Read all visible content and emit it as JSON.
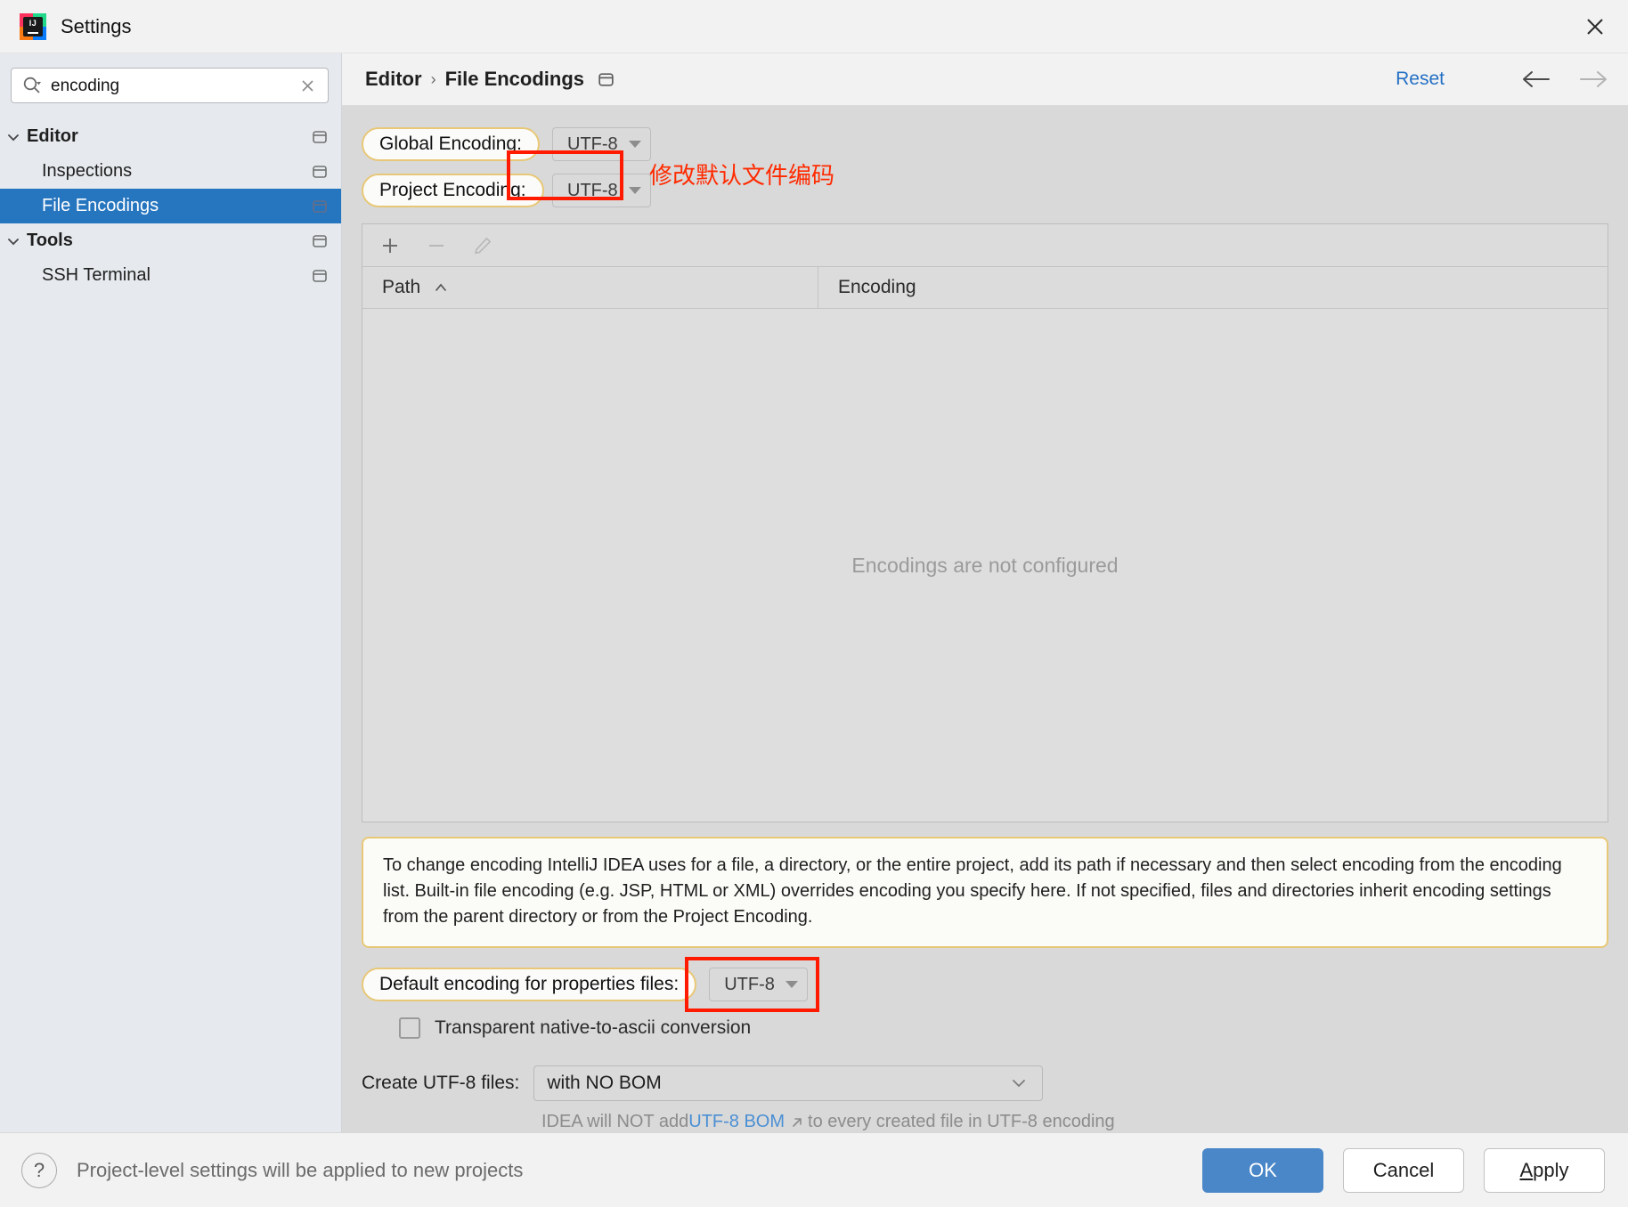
{
  "window": {
    "title": "Settings",
    "logo_text": "IJ",
    "close_icon": "close-icon"
  },
  "sidebar": {
    "search": {
      "value": "encoding",
      "placeholder": "Search settings",
      "icon": "search-icon",
      "clear_icon": "close-icon"
    },
    "items": [
      {
        "label": "Editor",
        "level": "group",
        "expanded": true,
        "selected": false,
        "chevron": "chevron-down-icon",
        "badge": "project-level-icon"
      },
      {
        "label": "Inspections",
        "level": "child",
        "expanded": false,
        "selected": false,
        "chevron": "",
        "badge": "project-level-icon"
      },
      {
        "label": "File Encodings",
        "level": "child",
        "expanded": false,
        "selected": true,
        "chevron": "",
        "badge": "project-level-icon"
      },
      {
        "label": "Tools",
        "level": "group",
        "expanded": true,
        "selected": false,
        "chevron": "chevron-down-icon",
        "badge": "project-level-icon"
      },
      {
        "label": "SSH Terminal",
        "level": "child",
        "expanded": false,
        "selected": false,
        "chevron": "",
        "badge": "project-level-icon"
      }
    ]
  },
  "header": {
    "breadcrumb": [
      "Editor",
      "File Encodings"
    ],
    "separator": "›",
    "badge_icon": "project-level-icon",
    "reset_label": "Reset",
    "back_icon": "arrow-left-icon",
    "forward_icon": "arrow-right-icon"
  },
  "encodings": {
    "global": {
      "label": "Global Encoding:",
      "value": "UTF-8"
    },
    "project": {
      "label": "Project Encoding:",
      "value": "UTF-8"
    }
  },
  "annotation": {
    "text": "修改默认文件编码",
    "color": "#ff2a00"
  },
  "table": {
    "toolbar": {
      "add_icon": "plus-icon",
      "remove_icon": "minus-icon",
      "edit_icon": "pencil-icon"
    },
    "columns": [
      "Path",
      "Encoding"
    ],
    "sort_icon": "caret-up-icon",
    "rows": [],
    "empty_message": "Encodings are not configured"
  },
  "info": {
    "text": "To change encoding IntelliJ IDEA uses for a file, a directory, or the entire project, add its path if necessary and then select encoding from the encoding list. Built-in file encoding (e.g. JSP, HTML or XML) overrides encoding you specify here. If not specified, files and directories inherit encoding settings from the parent directory or from the Project Encoding."
  },
  "properties": {
    "label": "Default encoding for properties files:",
    "value": "UTF-8",
    "checkbox_label": "Transparent native-to-ascii conversion",
    "checkbox_checked": false
  },
  "bom": {
    "label": "Create UTF-8 files:",
    "value": "with NO BOM",
    "chevron": "chevron-down-icon",
    "hint_before": "IDEA will NOT add ",
    "hint_link": "UTF-8 BOM",
    "hint_link_icon": "external-link-icon",
    "hint_after": "to every created file in UTF-8 encoding"
  },
  "footer": {
    "help_icon": "question-mark-icon",
    "status": "Project-level settings will be applied to new projects",
    "ok_label": "OK",
    "cancel_label": "Cancel",
    "apply_label_mnemonic": "A",
    "apply_label_rest": "pply"
  }
}
